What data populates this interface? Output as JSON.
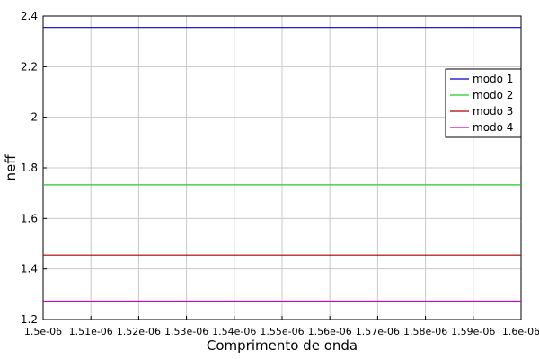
{
  "chart_data": {
    "type": "line",
    "xlabel": "Comprimento de onda",
    "ylabel": "neff",
    "xlim": [
      1.5e-06,
      1.6e-06
    ],
    "ylim": [
      1.2,
      2.4
    ],
    "x_ticks": [
      1.5e-06,
      1.51e-06,
      1.52e-06,
      1.53e-06,
      1.54e-06,
      1.55e-06,
      1.56e-06,
      1.57e-06,
      1.58e-06,
      1.59e-06,
      1.6e-06
    ],
    "x_tick_labels": [
      "1.5e-06",
      "1.51e-06",
      "1.52e-06",
      "1.53e-06",
      "1.54e-06",
      "1.55e-06",
      "1.56e-06",
      "1.57e-06",
      "1.58e-06",
      "1.59e-06",
      "1.6e-06"
    ],
    "y_ticks": [
      1.2,
      1.4,
      1.6,
      1.8,
      2.0,
      2.2,
      2.4
    ],
    "y_tick_labels": [
      "1.2",
      "1.4",
      "1.6",
      "1.8",
      "2",
      "2.2",
      "2.4"
    ],
    "grid": true,
    "legend_position": "top-right",
    "x": [
      1.5e-06,
      1.6e-06
    ],
    "series": [
      {
        "name": "modo 1",
        "color": "#0000cc",
        "values": [
          2.355,
          2.355
        ]
      },
      {
        "name": "modo 2",
        "color": "#22cc22",
        "values": [
          1.733,
          1.733
        ]
      },
      {
        "name": "modo 3",
        "color": "#aa0000",
        "values": [
          1.455,
          1.455
        ]
      },
      {
        "name": "modo 4",
        "color": "#cc00cc",
        "values": [
          1.273,
          1.273
        ]
      }
    ]
  }
}
